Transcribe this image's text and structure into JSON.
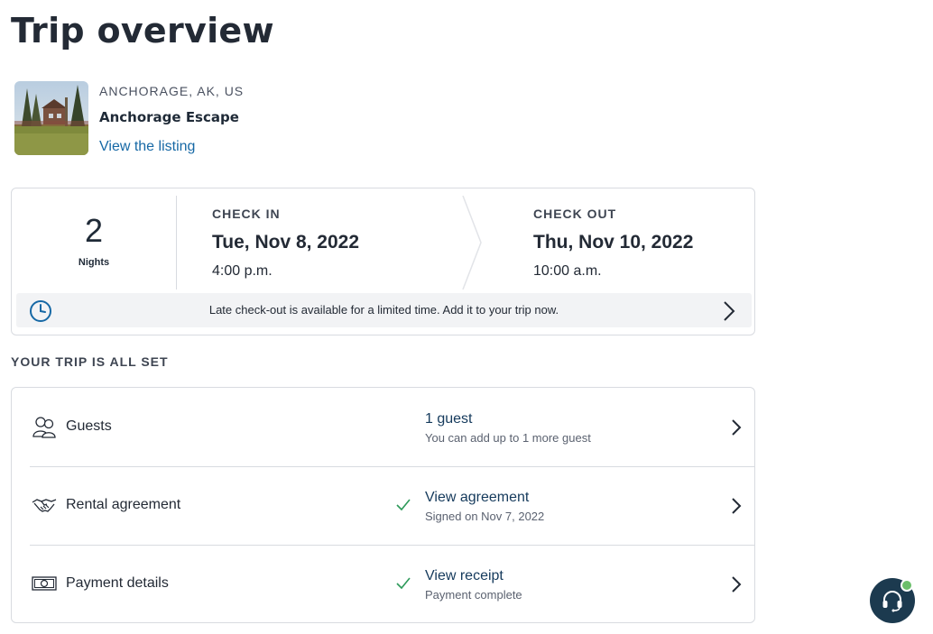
{
  "page": {
    "title": "Trip overview"
  },
  "listing": {
    "location": "ANCHORAGE, AK, US",
    "name": "Anchorage Escape",
    "link_label": "View the listing"
  },
  "stay": {
    "nights_count": "2",
    "nights_label": "Nights",
    "check_in": {
      "label": "CHECK IN",
      "date": "Tue, Nov 8, 2022",
      "time": "4:00 p.m."
    },
    "check_out": {
      "label": "CHECK OUT",
      "date": "Thu, Nov 10, 2022",
      "time": "10:00 a.m."
    },
    "late_checkout_banner": "Late check-out is available for a limited time. Add it to your trip now."
  },
  "summary": {
    "heading": "YOUR TRIP IS ALL SET",
    "rows": [
      {
        "icon": "guests-icon",
        "label": "Guests",
        "primary": "1 guest",
        "secondary": "You can add up to 1 more guest",
        "checked": false
      },
      {
        "icon": "handshake-icon",
        "label": "Rental agreement",
        "primary": "View agreement",
        "secondary": "Signed on Nov 7, 2022",
        "checked": true
      },
      {
        "icon": "payment-icon",
        "label": "Payment details",
        "primary": "View receipt",
        "secondary": "Payment complete",
        "checked": true
      }
    ]
  },
  "support": {
    "icon": "headset-icon",
    "status": "online"
  },
  "colors": {
    "link": "#1668a5",
    "check": "#2e9a5a",
    "support_bg": "#1c3a4f",
    "online": "#6bbf6b"
  }
}
